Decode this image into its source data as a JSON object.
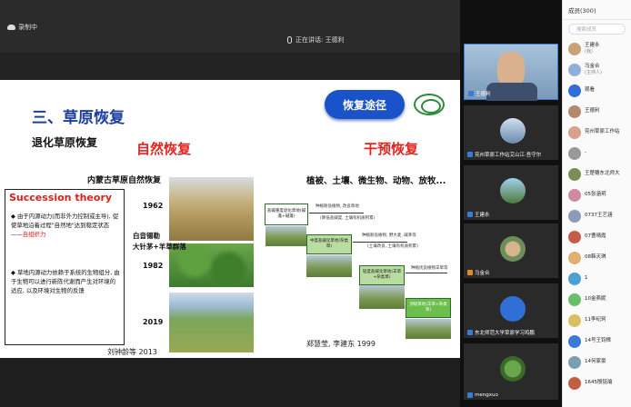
{
  "topbar": {
    "recording": "录制中",
    "speaking": "正在讲话: 王德利"
  },
  "slide": {
    "title": "三、草原恢复",
    "subtitle": "退化草原恢复",
    "badge": "恢复途径",
    "natural": "自然恢复",
    "intervention": "干预恢复",
    "nm_title": "内蒙古草原自然恢复",
    "int_line": "植被、土壤、微生物、动物、放牧...",
    "years": [
      "1962",
      "1982",
      "2019"
    ],
    "stage": [
      "白音锡勒",
      "大针茅+羊草群落"
    ],
    "cite_left": "刘钟龄等 2013",
    "cite_right": "郑慧莹, 李建东 1999",
    "succession": {
      "title": "Succession theory",
      "b1": "由于内源动力(而非外力控制或主导), 促使草地沿着过程\"自然地\"达到稳定状态——",
      "b1_red": "自组织力",
      "b2": "草地内源动力依赖于系统的生物组分, 由于生物可以进行新陈代谢而产生对环境的适应, 以及环境对生物的反馈"
    },
    "diagram": {
      "n1": "盐碱重度退化草地(碱蓬+碱蓬)",
      "n2": "中度盐碱化草地(杂类草)",
      "n3": "轻度盐碱化草地(羊草+杂类草)",
      "n4": "顶级草地(羊草+杂类草)",
      "a1": "种植耐盐植物, 改良草地",
      "a2": "(降低盐碱度, 土壤有机质积累)",
      "a3": "种植耐盐植物, 野大麦, 碱茅等",
      "a4": "(土壤改良, 土壤有机质积累)",
      "a5": "种植优良植物羊草等"
    }
  },
  "videos": [
    {
      "name": "王德利"
    },
    {
      "name": "兖州草原工作站艾山江·吾守尔"
    },
    {
      "name": "王建永"
    },
    {
      "name": "马金合"
    },
    {
      "name": "东北师范大学草原学习鸡鹏"
    },
    {
      "name": "mengxuo"
    }
  ],
  "members": {
    "header": "成员(300)",
    "search_placeholder": "搜索成员",
    "list": [
      {
        "name": "王建永",
        "sub": "(我)"
      },
      {
        "name": "马金合",
        "sub": "(主持人)"
      },
      {
        "name": "观看",
        "sub": ""
      },
      {
        "name": "王德利",
        "sub": ""
      },
      {
        "name": "兖州草原工作站",
        "sub": ""
      },
      {
        "name": "-",
        "sub": ""
      },
      {
        "name": "王楚穗东北师大",
        "sub": ""
      },
      {
        "name": "05张涵玥",
        "sub": ""
      },
      {
        "name": "0737王艺涵",
        "sub": ""
      },
      {
        "name": "07曹晴霞",
        "sub": ""
      },
      {
        "name": "08韩天琪",
        "sub": ""
      },
      {
        "name": "1",
        "sub": ""
      },
      {
        "name": "10金燕妮",
        "sub": ""
      },
      {
        "name": "11李纪珂",
        "sub": ""
      },
      {
        "name": "14号王钧樟",
        "sub": ""
      },
      {
        "name": "14何家豪",
        "sub": ""
      },
      {
        "name": "1645殷铭瑜",
        "sub": ""
      }
    ]
  }
}
